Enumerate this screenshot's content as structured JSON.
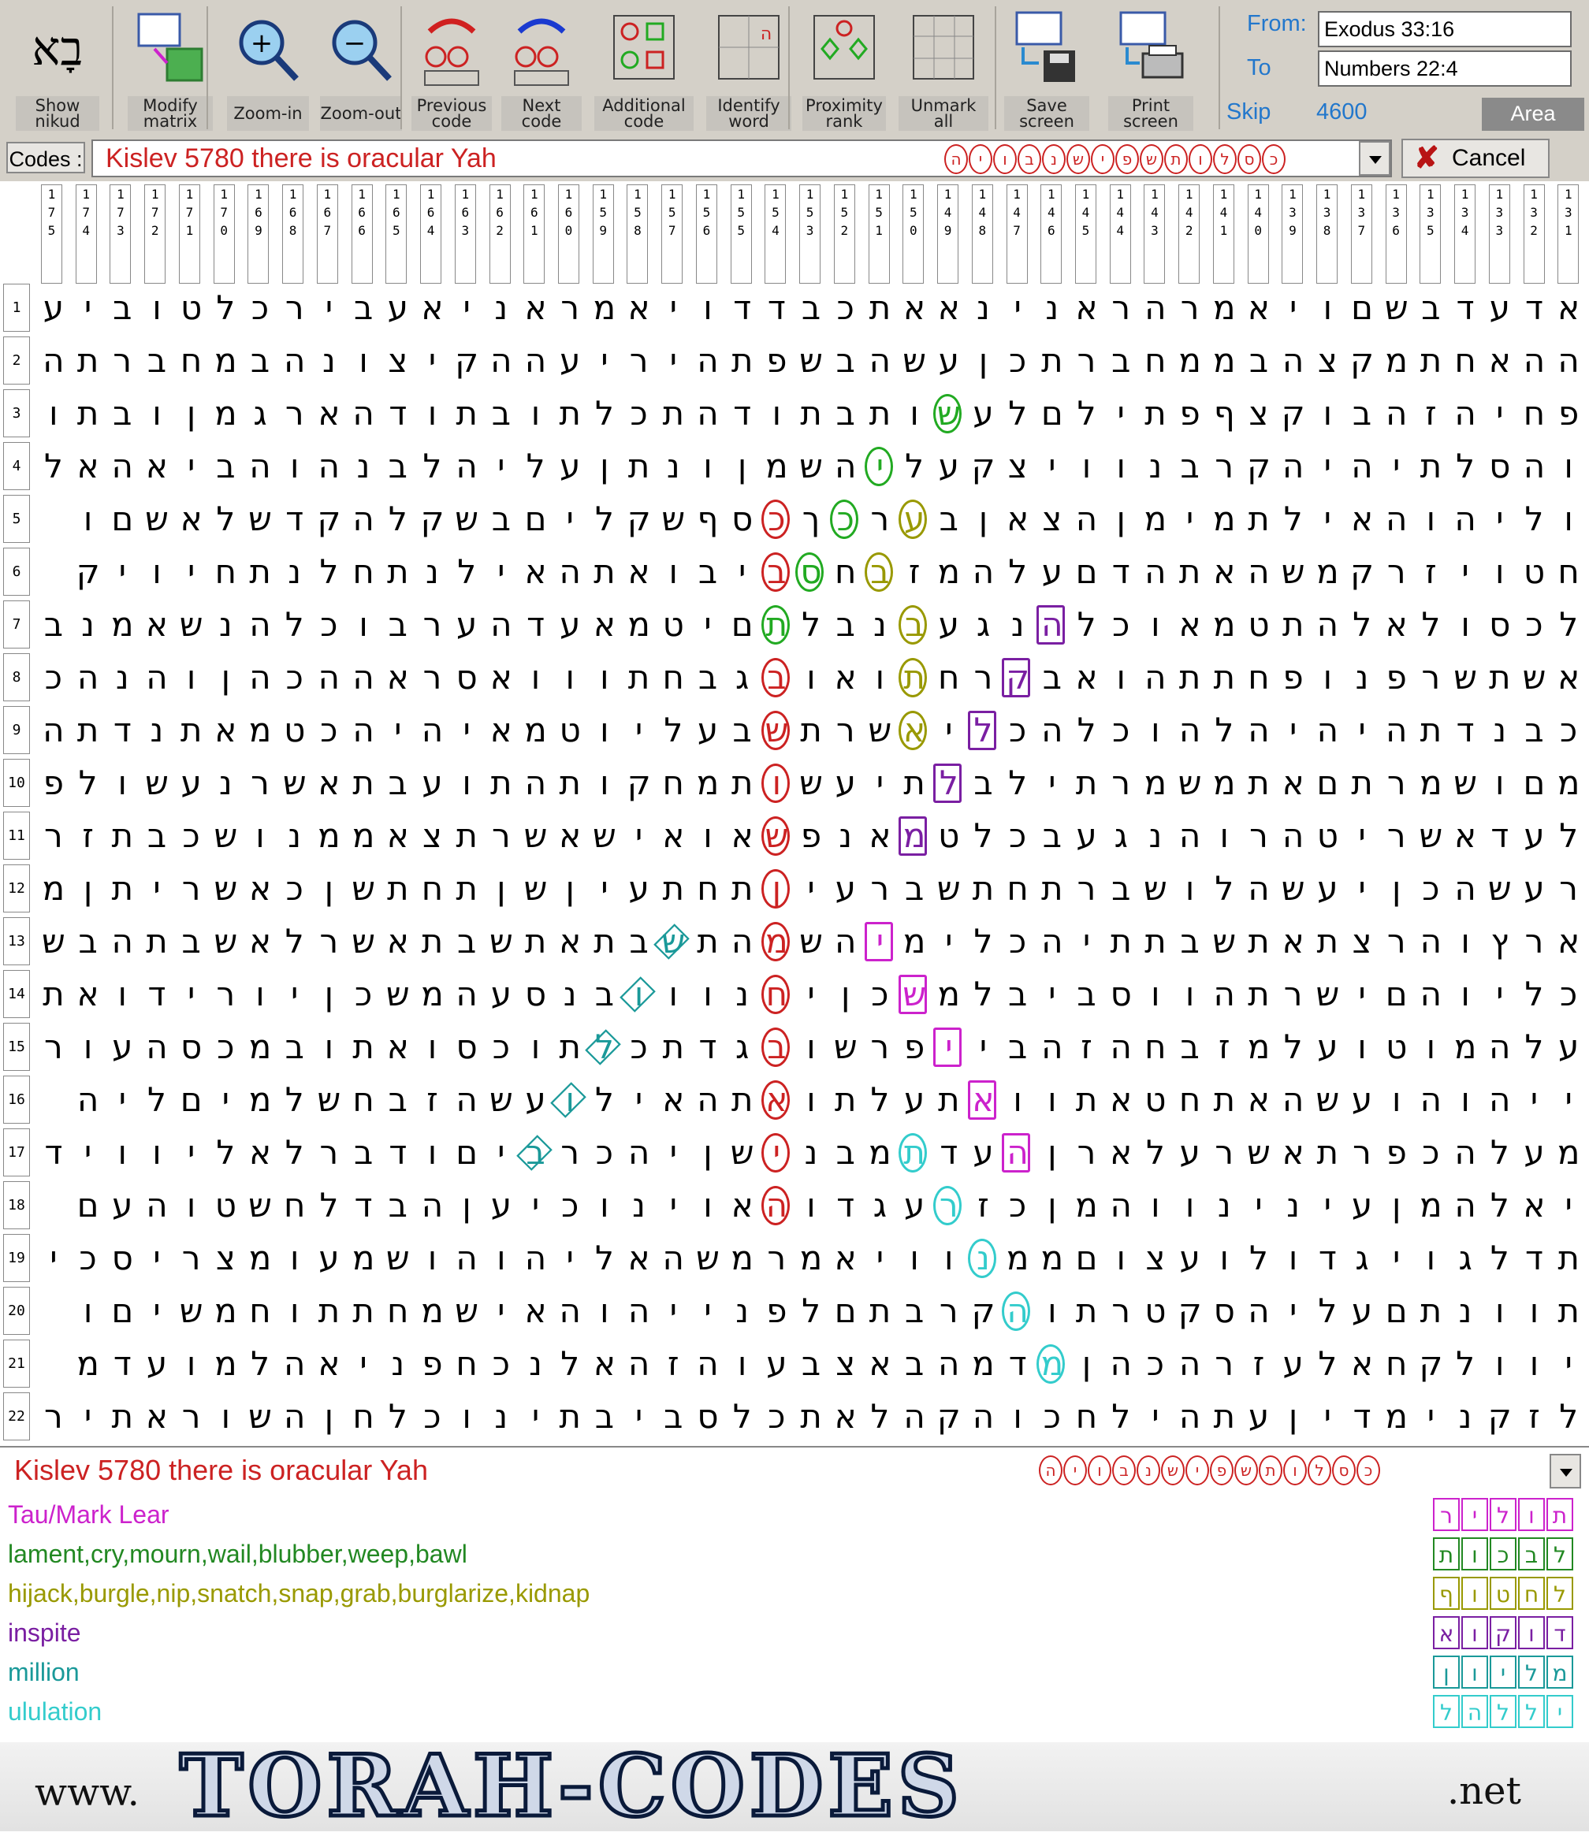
{
  "toolbar": {
    "buttons": [
      {
        "label": "Show\nnikud",
        "icon": "bet-aleph-nikud-icon"
      },
      {
        "label": "Modify\nmatrix",
        "icon": "matrix-grid-icon"
      },
      {
        "label": "Zoom-in",
        "icon": "zoom-in-icon"
      },
      {
        "label": "Zoom-out",
        "icon": "zoom-out-icon"
      },
      {
        "label": "Previous\ncode",
        "icon": "previous-code-icon"
      },
      {
        "label": "Next\ncode",
        "icon": "next-code-icon"
      },
      {
        "label": "Additional\ncode",
        "icon": "additional-code-icon"
      },
      {
        "label": "Identify\nword",
        "icon": "identify-word-icon"
      },
      {
        "label": "Proximity\nrank",
        "icon": "proximity-rank-icon"
      },
      {
        "label": "Unmark\nall",
        "icon": "unmark-all-icon"
      },
      {
        "label": "Save\nscreen",
        "icon": "save-screen-icon"
      },
      {
        "label": "Print\nscreen",
        "icon": "print-screen-icon"
      }
    ],
    "from_label": "From:",
    "from_value": "Exodus 33:16",
    "to_label": "To",
    "to_value": "Numbers 22:4",
    "skip_label": "Skip",
    "skip_value": "4600",
    "area_label": "Area"
  },
  "codes_bar": {
    "label": "Codes :",
    "text": "Kislev 5780 there is oracular Yah",
    "letters": [
      "כ",
      "ס",
      "ל",
      "ו",
      "ת",
      "ש",
      "פ",
      "י",
      "ש",
      "נ",
      "ב",
      "ו",
      "י",
      "ה"
    ],
    "cancel_label": "Cancel"
  },
  "grid": {
    "columns": [
      "1\n7\n5",
      "1\n7\n4",
      "1\n7\n3",
      "1\n7\n2",
      "1\n7\n1",
      "1\n7\n0",
      "1\n6\n9",
      "1\n6\n8",
      "1\n6\n7",
      "1\n6\n6",
      "1\n6\n5",
      "1\n6\n4",
      "1\n6\n3",
      "1\n6\n2",
      "1\n6\n1",
      "1\n6\n0",
      "1\n5\n9",
      "1\n5\n8",
      "1\n5\n7",
      "1\n5\n6",
      "1\n5\n5",
      "1\n5\n4",
      "1\n5\n3",
      "1\n5\n2",
      "1\n5\n1",
      "1\n5\n0",
      "1\n4\n9",
      "1\n4\n8",
      "1\n4\n7",
      "1\n4\n6",
      "1\n4\n5",
      "1\n4\n4",
      "1\n4\n3",
      "1\n4\n2",
      "1\n4\n1",
      "1\n4\n0",
      "1\n3\n9",
      "1\n3\n8",
      "1\n3\n7",
      "1\n3\n6",
      "1\n3\n5",
      "1\n3\n4",
      "1\n3\n3",
      "1\n3\n2",
      "1\n3\n1"
    ],
    "rows": [
      "אדעדבשםויאמרהראנינאאתכבדדויאמראניאעבירכלטוביע",
      "ההאחתמקצהבממחברתכןעשהבשפתהיריעההקיצונהבמחברתהש",
      "פחיהזהבוקצףפתילםלעשותבתודהתכלתובתודהארגמןובתו",
      "והסלתיהיהקרבנוויצקעליהשמןונתןעליהלבנהוהביאהאל",
      "וליהוהאילתמימןהצאןבערכךכסףשקליםבשקלהקדשלאשםו",
      "חטויזרקמשהאתהדםעלהמזבחסביבואתהאילנתחלנתחיויק",
      "לכסולאלהתטמאוכלהנגעבנבלתםיטמאעדהערבוכלהנשאמנב",
      "אשתשרפנופחתתהואבקרחתואובגבחתווואסראההכהןוהנהכה",
      "כבנדתהיהיהלהוכלהכליאשרתשבעליוטמאיהיהכטמאתנדתה",
      "מםושמרתםאתמשמרתילבלתיעשותמחקותהתועבתאשרנעשולפ",
      "לעדאשריטהרוהנגעבכלטמאנפשאואישאשרתצאממנושכבתזר",
      "רעשהכןיעשהלושברתחתשברעיןתחתעיןשןתחתשןכאשריתןמ",
      "ארץוהרצתאתשבתתיהכלימיהשמהתשבתאתשבתאשרלאשבתהבשבתת",
      "כליוהםישרתהווסביבלמשכןיחנווובנסעהמשכןיורידואת",
      "עלהמוטועלמזבחהזהבייפרשובגדתכלתוכסואתובמכסהעורת",
      "ייהוהועשהאתחטאתוואתעלתואתהאילועשהזבחשלמיםליה",
      "מעלהכפרתאשרעלארןהעדתמבנישןיהכרביםודברלאליוויד",
      "יאלהמןעינינווהמןכזרעגדוהאוינוכיעןהבדלחשטוהעם",
      "תדלגויגדולועצוםממנוויאמרמשהאליהוהושמעומצריסכי",
      "תוונתםעליהסקטרתוהקרבתםלפנייהוהאישמחתתוחמשיםו",
      "יוולקחאלעזרהכהןמדמהבאצבעוהזהאלנכחפניאהלמועדמ",
      "לזקנימדיןעתהילחכוהקהלאתכלסביבתינוכלחןהשוראתיר"
    ],
    "marks": [
      {
        "row": 3,
        "col": 18,
        "color": "#22aa22",
        "shape": "oval"
      },
      {
        "row": 4,
        "col": 20,
        "color": "#22aa22",
        "shape": "oval"
      },
      {
        "row": 5,
        "col": 19,
        "color": "#999900",
        "shape": "oval"
      },
      {
        "row": 5,
        "col": 21,
        "color": "#22aa22",
        "shape": "oval"
      },
      {
        "row": 5,
        "col": 23,
        "color": "#cc2222",
        "shape": "oval"
      },
      {
        "row": 6,
        "col": 20,
        "color": "#999900",
        "shape": "oval"
      },
      {
        "row": 6,
        "col": 22,
        "color": "#22aa22",
        "shape": "oval"
      },
      {
        "row": 6,
        "col": 23,
        "color": "#cc2222",
        "shape": "oval"
      },
      {
        "row": 7,
        "col": 15,
        "color": "#7a1fa2",
        "shape": "rect"
      },
      {
        "row": 7,
        "col": 19,
        "color": "#999900",
        "shape": "oval"
      },
      {
        "row": 7,
        "col": 23,
        "color": "#22aa22",
        "shape": "oval"
      },
      {
        "row": 8,
        "col": 16,
        "color": "#7a1fa2",
        "shape": "rect"
      },
      {
        "row": 8,
        "col": 19,
        "color": "#999900",
        "shape": "oval"
      },
      {
        "row": 8,
        "col": 23,
        "color": "#cc2222",
        "shape": "oval"
      },
      {
        "row": 9,
        "col": 17,
        "color": "#7a1fa2",
        "shape": "rect"
      },
      {
        "row": 9,
        "col": 19,
        "color": "#999900",
        "shape": "oval"
      },
      {
        "row": 9,
        "col": 23,
        "color": "#cc2222",
        "shape": "oval"
      },
      {
        "row": 10,
        "col": 18,
        "color": "#7a1fa2",
        "shape": "rect"
      },
      {
        "row": 10,
        "col": 23,
        "color": "#cc2222",
        "shape": "oval"
      },
      {
        "row": 11,
        "col": 19,
        "color": "#7a1fa2",
        "shape": "rect"
      },
      {
        "row": 11,
        "col": 23,
        "color": "#cc2222",
        "shape": "oval"
      },
      {
        "row": 12,
        "col": 23,
        "color": "#cc2222",
        "shape": "oval"
      },
      {
        "row": 13,
        "col": 20,
        "color": "#cc22cc",
        "shape": "rect"
      },
      {
        "row": 13,
        "col": 23,
        "color": "#cc2222",
        "shape": "oval"
      },
      {
        "row": 13,
        "col": 26,
        "color": "#1a9999",
        "shape": "diamond"
      },
      {
        "row": 14,
        "col": 19,
        "color": "#cc22cc",
        "shape": "rect"
      },
      {
        "row": 14,
        "col": 23,
        "color": "#cc2222",
        "shape": "oval"
      },
      {
        "row": 14,
        "col": 27,
        "color": "#1a9999",
        "shape": "diamond"
      },
      {
        "row": 15,
        "col": 18,
        "color": "#cc22cc",
        "shape": "rect"
      },
      {
        "row": 15,
        "col": 23,
        "color": "#cc2222",
        "shape": "oval"
      },
      {
        "row": 15,
        "col": 28,
        "color": "#1a9999",
        "shape": "diamond"
      },
      {
        "row": 16,
        "col": 17,
        "color": "#cc22cc",
        "shape": "rect"
      },
      {
        "row": 16,
        "col": 23,
        "color": "#cc2222",
        "shape": "oval"
      },
      {
        "row": 16,
        "col": 29,
        "color": "#1a9999",
        "shape": "diamond"
      },
      {
        "row": 17,
        "col": 16,
        "color": "#cc22cc",
        "shape": "rect"
      },
      {
        "row": 17,
        "col": 19,
        "color": "#33cccc",
        "shape": "oval"
      },
      {
        "row": 17,
        "col": 23,
        "color": "#cc2222",
        "shape": "oval"
      },
      {
        "row": 17,
        "col": 30,
        "color": "#1a9999",
        "shape": "diamond"
      },
      {
        "row": 18,
        "col": 18,
        "color": "#33cccc",
        "shape": "oval"
      },
      {
        "row": 18,
        "col": 23,
        "color": "#cc2222",
        "shape": "oval"
      },
      {
        "row": 19,
        "col": 17,
        "color": "#33cccc",
        "shape": "oval"
      },
      {
        "row": 20,
        "col": 16,
        "color": "#33cccc",
        "shape": "oval"
      },
      {
        "row": 21,
        "col": 15,
        "color": "#33cccc",
        "shape": "oval"
      }
    ]
  },
  "bottom_codes": {
    "text": "Kislev 5780 there is oracular Yah",
    "letters": [
      "כ",
      "ס",
      "ל",
      "ו",
      "ת",
      "ש",
      "פ",
      "י",
      "ש",
      "נ",
      "ב",
      "ו",
      "י",
      "ה"
    ]
  },
  "findings": [
    {
      "text": "Tau/Mark Lear",
      "color": "#cc22cc",
      "letters": [
        "ת",
        "ו",
        "ל",
        "י",
        "ר"
      ]
    },
    {
      "text": "lament,cry,mourn,wail,blubber,weep,bawl",
      "color": "#228822",
      "letters": [
        "ל",
        "ב",
        "כ",
        "ו",
        "ת"
      ]
    },
    {
      "text": "hijack,burgle,nip,snatch,snap,grab,burglarize,kidnap",
      "color": "#999900",
      "letters": [
        "ל",
        "ח",
        "ט",
        "ו",
        "ף"
      ]
    },
    {
      "text": "inspite",
      "color": "#7a1fa2",
      "letters": [
        "ד",
        "ו",
        "ק",
        "ו",
        "א"
      ]
    },
    {
      "text": "million",
      "color": "#1a9999",
      "letters": [
        "מ",
        "ל",
        "י",
        "ו",
        "ן"
      ]
    },
    {
      "text": "ululation",
      "color": "#33cccc",
      "letters": [
        "י",
        "ל",
        "ל",
        "ה",
        "ל"
      ]
    }
  ],
  "logo": {
    "www": "www.",
    "main": "TORAH-CODES",
    "net": ".net"
  }
}
